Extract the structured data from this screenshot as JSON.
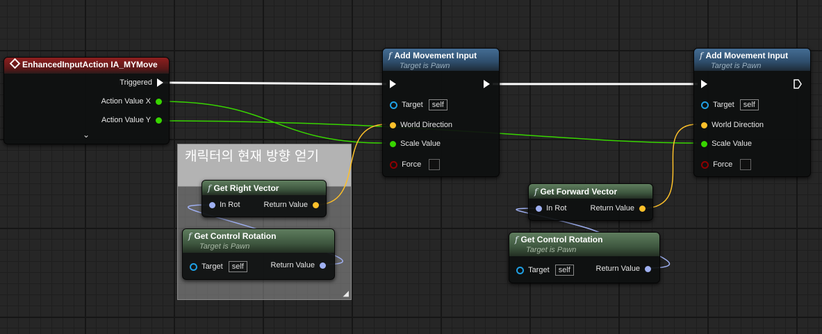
{
  "comment": {
    "text": "캐릭터의 현재 방향 얻기"
  },
  "event_node": {
    "title": "EnhancedInputAction IA_MYMove",
    "pins": {
      "triggered": "Triggered",
      "action_x": "Action Value X",
      "action_y": "Action Value Y"
    },
    "expand": "⌄"
  },
  "add_movement_1": {
    "title": "Add Movement Input",
    "subtitle": "Target is Pawn",
    "pins": {
      "target": "Target",
      "target_value": "self",
      "world_direction": "World Direction",
      "scale_value": "Scale Value",
      "force": "Force"
    }
  },
  "add_movement_2": {
    "title": "Add Movement Input",
    "subtitle": "Target is Pawn",
    "pins": {
      "target": "Target",
      "target_value": "self",
      "world_direction": "World Direction",
      "scale_value": "Scale Value",
      "force": "Force"
    }
  },
  "get_right_vector": {
    "title": "Get Right Vector",
    "pins": {
      "in_rot": "In Rot",
      "return_value": "Return Value"
    }
  },
  "get_forward_vector": {
    "title": "Get Forward Vector",
    "pins": {
      "in_rot": "In Rot",
      "return_value": "Return Value"
    }
  },
  "get_control_rotation_1": {
    "title": "Get Control Rotation",
    "subtitle": "Target is Pawn",
    "pins": {
      "target": "Target",
      "target_value": "self",
      "return_value": "Return Value"
    }
  },
  "get_control_rotation_2": {
    "title": "Get Control Rotation",
    "subtitle": "Target is Pawn",
    "pins": {
      "target": "Target",
      "target_value": "self",
      "return_value": "Return Value"
    }
  },
  "colors": {
    "exec": "#ffffff",
    "float": "#38d500",
    "vector": "#fdc02a",
    "rotator": "#9fb0f2",
    "object": "#1fa0e4",
    "bool": "#8e0000"
  }
}
